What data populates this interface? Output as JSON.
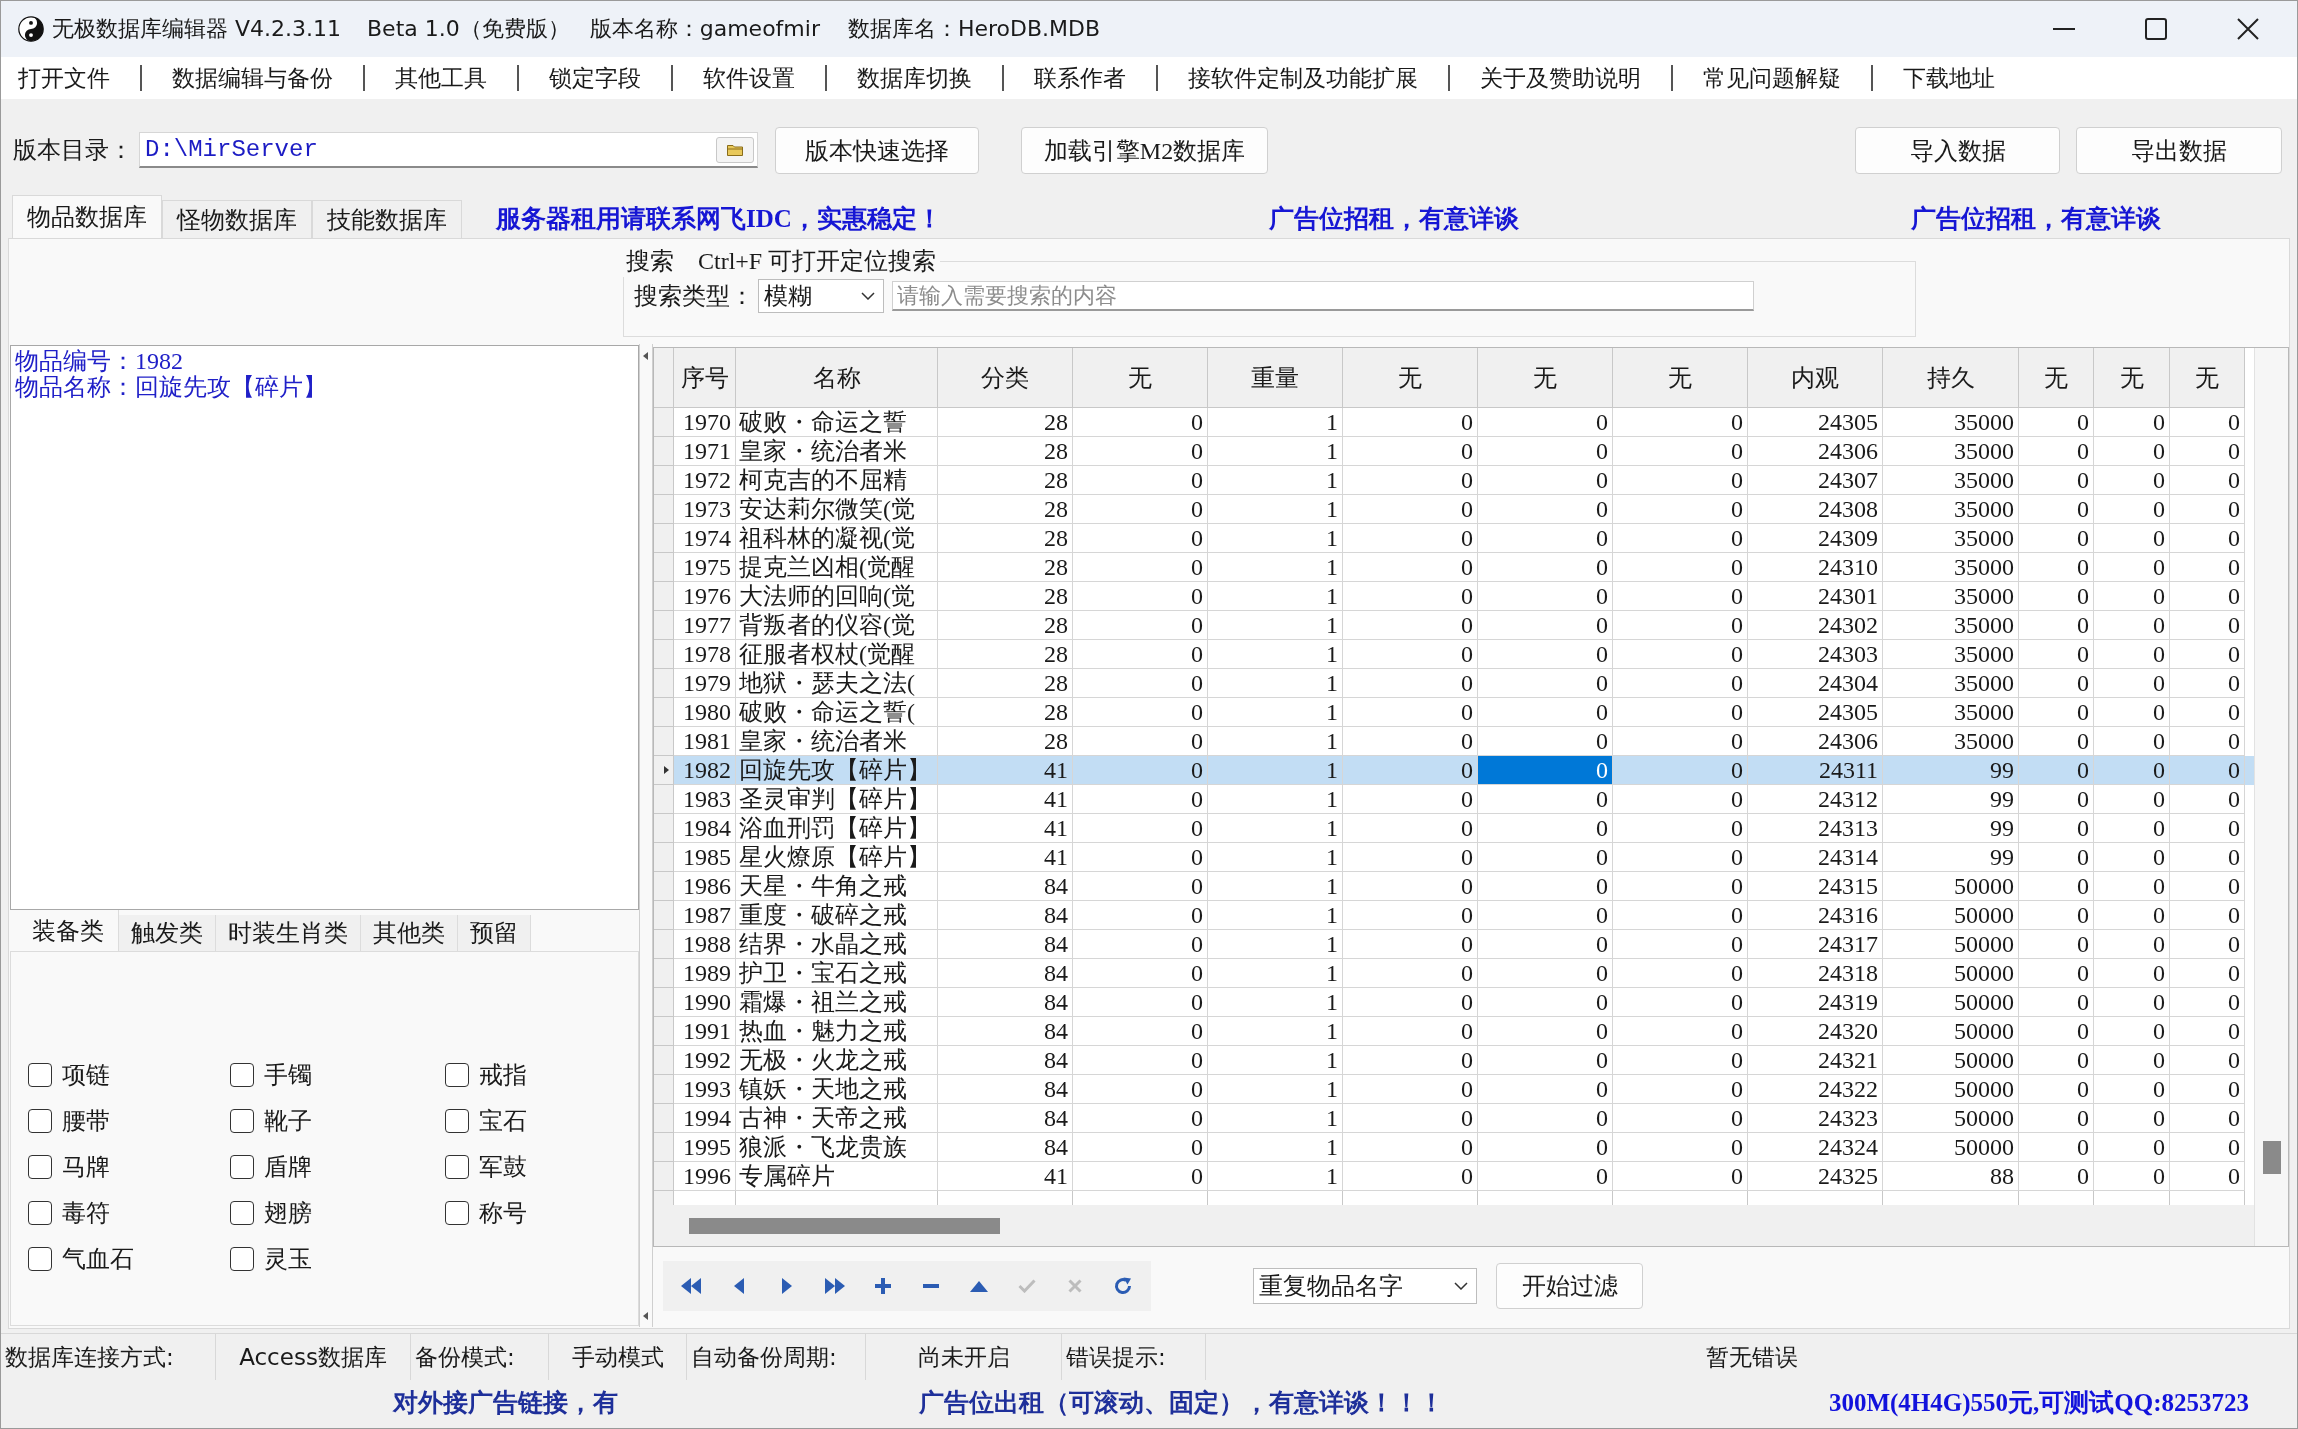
{
  "window": {
    "title": "无极数据库编辑器 V4.2.3.11",
    "edition": "Beta 1.0（免费版）",
    "version_name": "版本名称：gameofmir",
    "database_name": "数据库名：HeroDB.MDB"
  },
  "menu": [
    "打开文件",
    "数据编辑与备份",
    "其他工具",
    "锁定字段",
    "软件设置",
    "数据库切换",
    "联系作者",
    "接软件定制及功能扩展",
    "关于及赞助说明",
    "常见问题解疑",
    "下载地址"
  ],
  "version_bar": {
    "label": "版本目录：",
    "path": "D:\\MirServer",
    "buttons": [
      "版本快速选择",
      "加载引擎M2数据库"
    ],
    "right_buttons": [
      "导入数据",
      "导出数据"
    ]
  },
  "tabs": [
    {
      "label": "物品数据库",
      "selected": true
    },
    {
      "label": "怪物数据库",
      "selected": false
    },
    {
      "label": "技能数据库",
      "selected": false
    }
  ],
  "ads": [
    "服务器租用请联系网飞IDC，实惠稳定！",
    "广告位招租，有意详谈",
    "广告位招租，有意详谈"
  ],
  "search": {
    "title": "搜索",
    "hint": "Ctrl+F 可打开定位搜索",
    "type_label": "搜索类型：",
    "type_value": "模糊",
    "placeholder": "请输入需要搜索的内容"
  },
  "item_info": [
    "物品编号：1982",
    "物品名称：回旋先攻【碎片】"
  ],
  "category_tabs": [
    {
      "label": "装备类",
      "selected": true
    },
    {
      "label": "触发类",
      "selected": false
    },
    {
      "label": "时装生肖类",
      "selected": false
    },
    {
      "label": "其他类",
      "selected": false
    },
    {
      "label": "预留",
      "selected": false
    }
  ],
  "checkboxes": [
    {
      "label": "项链",
      "checked": false
    },
    {
      "label": "手镯",
      "checked": false
    },
    {
      "label": "戒指",
      "checked": false
    },
    {
      "label": "腰带",
      "checked": false
    },
    {
      "label": "靴子",
      "checked": false
    },
    {
      "label": "宝石",
      "checked": false
    },
    {
      "label": "马牌",
      "checked": false
    },
    {
      "label": "盾牌",
      "checked": false
    },
    {
      "label": "军鼓",
      "checked": false
    },
    {
      "label": "毒符",
      "checked": false
    },
    {
      "label": "翅膀",
      "checked": false
    },
    {
      "label": "称号",
      "checked": false
    },
    {
      "label": "气血石",
      "checked": false
    },
    {
      "label": "灵玉",
      "checked": false
    }
  ],
  "table": {
    "columns": [
      {
        "label": "序号",
        "kind": "number",
        "focused": false
      },
      {
        "label": "名称",
        "kind": "text",
        "focused": false
      },
      {
        "label": "分类",
        "kind": "number",
        "focused": false
      },
      {
        "label": "无",
        "kind": "number",
        "focused": false
      },
      {
        "label": "重量",
        "kind": "number",
        "focused": false
      },
      {
        "label": "无",
        "kind": "number",
        "focused": false
      },
      {
        "label": "无",
        "kind": "number",
        "focused": true
      },
      {
        "label": "无",
        "kind": "number",
        "focused": false
      },
      {
        "label": "内观",
        "kind": "number",
        "focused": false
      },
      {
        "label": "持久",
        "kind": "number",
        "focused": false
      },
      {
        "label": "无",
        "kind": "number",
        "focused": false
      },
      {
        "label": "无",
        "kind": "number",
        "focused": false
      },
      {
        "label": "无",
        "kind": "number",
        "focused": false
      }
    ],
    "rows": [
      {
        "selected": false,
        "cells": [
          "1970",
          "破败・命运之誓",
          "28",
          "0",
          "1",
          "0",
          "0",
          "0",
          "24305",
          "35000",
          "0",
          "0",
          "0"
        ]
      },
      {
        "selected": false,
        "cells": [
          "1971",
          "皇家・统治者米",
          "28",
          "0",
          "1",
          "0",
          "0",
          "0",
          "24306",
          "35000",
          "0",
          "0",
          "0"
        ]
      },
      {
        "selected": false,
        "cells": [
          "1972",
          "柯克吉的不屈精",
          "28",
          "0",
          "1",
          "0",
          "0",
          "0",
          "24307",
          "35000",
          "0",
          "0",
          "0"
        ]
      },
      {
        "selected": false,
        "cells": [
          "1973",
          "安达莉尔微笑(觉",
          "28",
          "0",
          "1",
          "0",
          "0",
          "0",
          "24308",
          "35000",
          "0",
          "0",
          "0"
        ]
      },
      {
        "selected": false,
        "cells": [
          "1974",
          "祖科林的凝视(觉",
          "28",
          "0",
          "1",
          "0",
          "0",
          "0",
          "24309",
          "35000",
          "0",
          "0",
          "0"
        ]
      },
      {
        "selected": false,
        "cells": [
          "1975",
          "提克兰凶相(觉醒",
          "28",
          "0",
          "1",
          "0",
          "0",
          "0",
          "24310",
          "35000",
          "0",
          "0",
          "0"
        ]
      },
      {
        "selected": false,
        "cells": [
          "1976",
          "大法师的回响(觉",
          "28",
          "0",
          "1",
          "0",
          "0",
          "0",
          "24301",
          "35000",
          "0",
          "0",
          "0"
        ]
      },
      {
        "selected": false,
        "cells": [
          "1977",
          "背叛者的仪容(觉",
          "28",
          "0",
          "1",
          "0",
          "0",
          "0",
          "24302",
          "35000",
          "0",
          "0",
          "0"
        ]
      },
      {
        "selected": false,
        "cells": [
          "1978",
          "征服者权杖(觉醒",
          "28",
          "0",
          "1",
          "0",
          "0",
          "0",
          "24303",
          "35000",
          "0",
          "0",
          "0"
        ]
      },
      {
        "selected": false,
        "cells": [
          "1979",
          "地狱・瑟夫之法(",
          "28",
          "0",
          "1",
          "0",
          "0",
          "0",
          "24304",
          "35000",
          "0",
          "0",
          "0"
        ]
      },
      {
        "selected": false,
        "cells": [
          "1980",
          "破败・命运之誓(",
          "28",
          "0",
          "1",
          "0",
          "0",
          "0",
          "24305",
          "35000",
          "0",
          "0",
          "0"
        ]
      },
      {
        "selected": false,
        "cells": [
          "1981",
          "皇家・统治者米",
          "28",
          "0",
          "1",
          "0",
          "0",
          "0",
          "24306",
          "35000",
          "0",
          "0",
          "0"
        ]
      },
      {
        "selected": true,
        "cells": [
          "1982",
          "回旋先攻【碎片】",
          "41",
          "0",
          "1",
          "0",
          "0",
          "0",
          "24311",
          "99",
          "0",
          "0",
          "0"
        ]
      },
      {
        "selected": false,
        "cells": [
          "1983",
          "圣灵审判【碎片】",
          "41",
          "0",
          "1",
          "0",
          "0",
          "0",
          "24312",
          "99",
          "0",
          "0",
          "0"
        ]
      },
      {
        "selected": false,
        "cells": [
          "1984",
          "浴血刑罚【碎片】",
          "41",
          "0",
          "1",
          "0",
          "0",
          "0",
          "24313",
          "99",
          "0",
          "0",
          "0"
        ]
      },
      {
        "selected": false,
        "cells": [
          "1985",
          "星火燎原【碎片】",
          "41",
          "0",
          "1",
          "0",
          "0",
          "0",
          "24314",
          "99",
          "0",
          "0",
          "0"
        ]
      },
      {
        "selected": false,
        "cells": [
          "1986",
          "天星・牛角之戒",
          "84",
          "0",
          "1",
          "0",
          "0",
          "0",
          "24315",
          "50000",
          "0",
          "0",
          "0"
        ]
      },
      {
        "selected": false,
        "cells": [
          "1987",
          "重度・破碎之戒",
          "84",
          "0",
          "1",
          "0",
          "0",
          "0",
          "24316",
          "50000",
          "0",
          "0",
          "0"
        ]
      },
      {
        "selected": false,
        "cells": [
          "1988",
          "结界・水晶之戒",
          "84",
          "0",
          "1",
          "0",
          "0",
          "0",
          "24317",
          "50000",
          "0",
          "0",
          "0"
        ]
      },
      {
        "selected": false,
        "cells": [
          "1989",
          "护卫・宝石之戒",
          "84",
          "0",
          "1",
          "0",
          "0",
          "0",
          "24318",
          "50000",
          "0",
          "0",
          "0"
        ]
      },
      {
        "selected": false,
        "cells": [
          "1990",
          "霜爆・祖兰之戒",
          "84",
          "0",
          "1",
          "0",
          "0",
          "0",
          "24319",
          "50000",
          "0",
          "0",
          "0"
        ]
      },
      {
        "selected": false,
        "cells": [
          "1991",
          "热血・魅力之戒",
          "84",
          "0",
          "1",
          "0",
          "0",
          "0",
          "24320",
          "50000",
          "0",
          "0",
          "0"
        ]
      },
      {
        "selected": false,
        "cells": [
          "1992",
          "无极・火龙之戒",
          "84",
          "0",
          "1",
          "0",
          "0",
          "0",
          "24321",
          "50000",
          "0",
          "0",
          "0"
        ]
      },
      {
        "selected": false,
        "cells": [
          "1993",
          "镇妖・天地之戒",
          "84",
          "0",
          "1",
          "0",
          "0",
          "0",
          "24322",
          "50000",
          "0",
          "0",
          "0"
        ]
      },
      {
        "selected": false,
        "cells": [
          "1994",
          "古神・天帝之戒",
          "84",
          "0",
          "1",
          "0",
          "0",
          "0",
          "24323",
          "50000",
          "0",
          "0",
          "0"
        ]
      },
      {
        "selected": false,
        "cells": [
          "1995",
          "狼派・飞龙贵族",
          "84",
          "0",
          "1",
          "0",
          "0",
          "0",
          "24324",
          "50000",
          "0",
          "0",
          "0"
        ]
      },
      {
        "selected": false,
        "cells": [
          "1996",
          "专属碎片",
          "41",
          "0",
          "1",
          "0",
          "0",
          "0",
          "24325",
          "88",
          "0",
          "0",
          "0"
        ]
      }
    ]
  },
  "navigator": [
    {
      "kind": "first",
      "disabled": false
    },
    {
      "kind": "prior",
      "disabled": false
    },
    {
      "kind": "next",
      "disabled": false
    },
    {
      "kind": "last",
      "disabled": false
    },
    {
      "kind": "insert",
      "disabled": false
    },
    {
      "kind": "delete",
      "disabled": false
    },
    {
      "kind": "edit",
      "disabled": false
    },
    {
      "kind": "post",
      "disabled": true
    },
    {
      "kind": "cancel",
      "disabled": true
    },
    {
      "kind": "refresh",
      "disabled": false
    }
  ],
  "filter": {
    "value": "重复物品名字",
    "button": "开始过滤"
  },
  "status_bar": [
    {
      "label": "数据库连接方式:",
      "value": "Access数据库"
    },
    {
      "label": "备份模式:",
      "value": "手动模式"
    },
    {
      "label": "自动备份周期:",
      "value": "尚未开启"
    },
    {
      "label": "错误提示:",
      "value": "暂无错误"
    }
  ],
  "footer_ads": [
    "对外接广告链接，有",
    "广告位出租（可滚动、固定），有意详谈！！！",
    "300M(4H4G)550元,可测试QQ:8253723"
  ]
}
